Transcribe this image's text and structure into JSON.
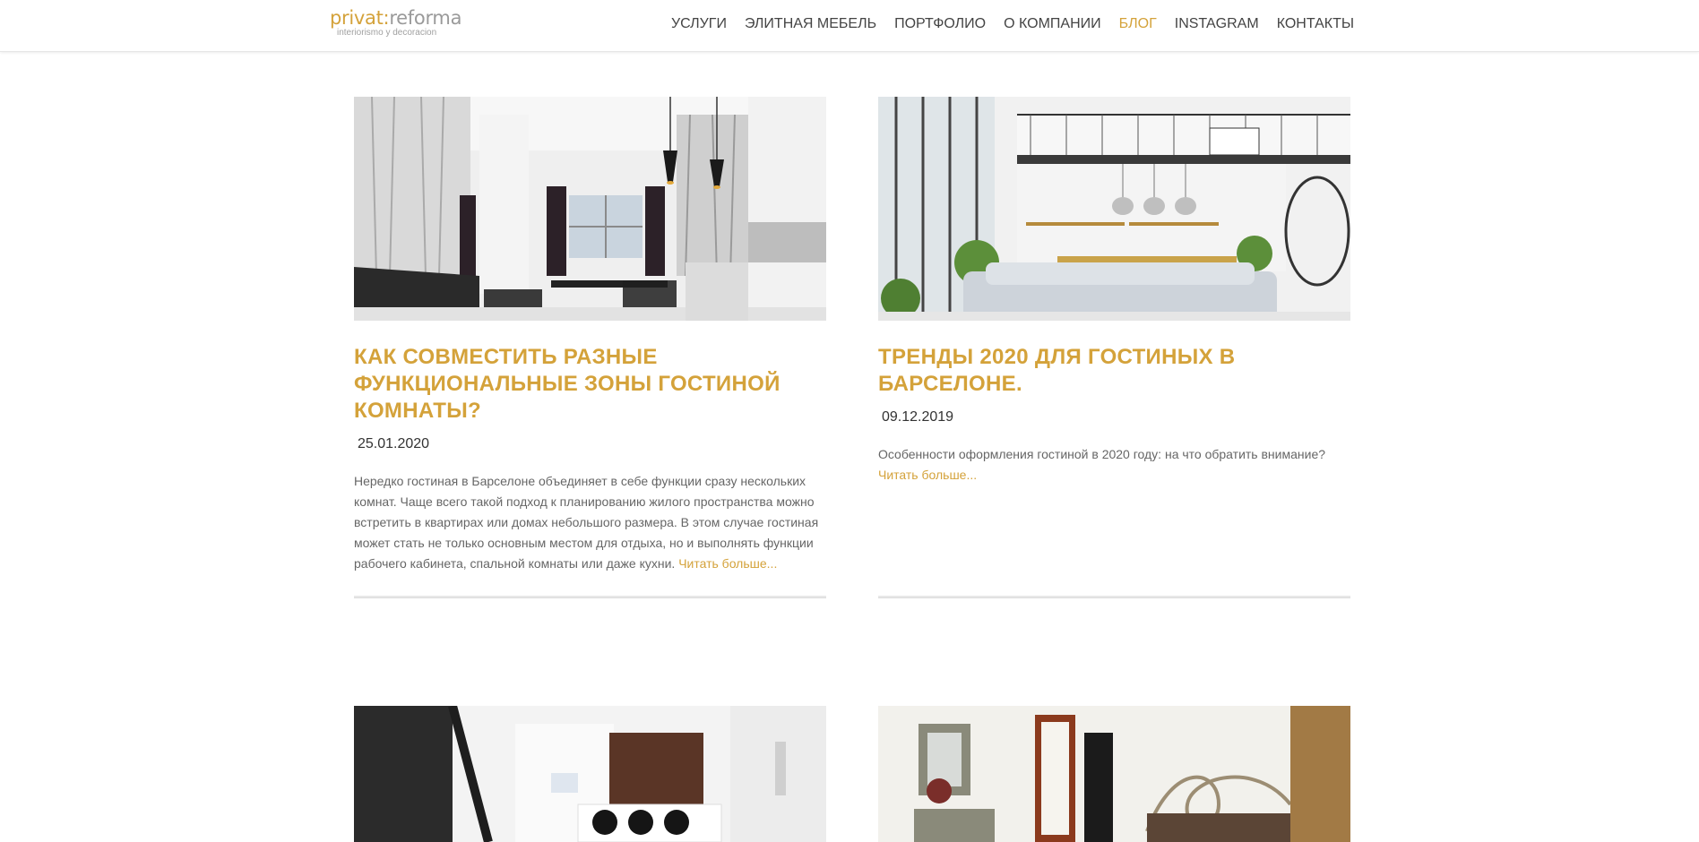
{
  "header": {
    "logo": {
      "part_a": "privat:",
      "part_b": "reforma",
      "tagline": "interiorismo y decoracion"
    },
    "nav": [
      {
        "label": "УСЛУГИ",
        "active": false
      },
      {
        "label": "ЭЛИТНАЯ МЕБЕЛЬ",
        "active": false
      },
      {
        "label": "ПОРТФОЛИО",
        "active": false
      },
      {
        "label": "О КОМПАНИИ",
        "active": false
      },
      {
        "label": "БЛОГ",
        "active": true
      },
      {
        "label": "INSTAGRAM",
        "active": false
      },
      {
        "label": "КОНТАКТЫ",
        "active": false
      }
    ]
  },
  "posts": [
    {
      "title": "КАК СОВМЕСТИТЬ РАЗНЫЕ ФУНКЦИОНАЛЬНЫЕ ЗОНЫ ГОСТИНОЙ КОМНАТЫ?",
      "date": "25.01.2020",
      "excerpt": "Нередко гостиная в Барселоне объединяет в себе функции сразу нескольких комнат. Чаще всего такой подход к планированию жилого пространства можно встретить в квартирах или домах небольшого размера. В этом случае гостиная может стать не только основным местом для отдыха, но и выполнять функции рабочего кабинета, спальной комнаты или даже кухни.",
      "read_more": "Читать больше..."
    },
    {
      "title": "ТРЕНДЫ 2020 ДЛЯ ГОСТИНЫХ В БАРСЕЛОНЕ.",
      "date": "09.12.2019",
      "excerpt": "Особенности оформления гостиной в 2020 году: на что обратить внимание?",
      "read_more": "Читать больше..."
    }
  ],
  "colors": {
    "accent": "#d4a23a",
    "text": "#333333",
    "muted": "#666666",
    "nav": "#444444"
  }
}
